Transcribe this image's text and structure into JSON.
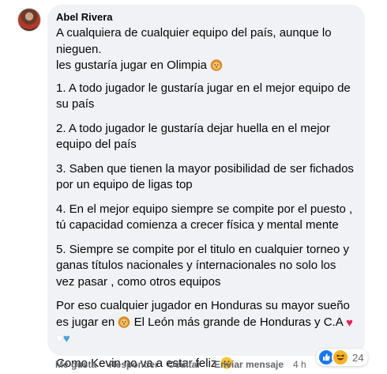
{
  "comment": {
    "author": "Abel Rivera",
    "paragraphs": {
      "p0_line1": "A cualquiera de cualquier equipo del país, aunque lo nieguen.",
      "p0_line2": "les gustaría jugar en Olimpia",
      "p1": "1. A todo jugador le gustaría jugar en el mejor equipo de su país",
      "p2": "2. A todo jugador le gustaría dejar huella en el mejor equipo del país",
      "p3": "3. Saben que tienen la mayor posibilidad de ser fichados por un equipo de ligas top",
      "p4": "4. En el mejor equipo siempre se compite por el puesto , tú capacidad comienza a crecer física y mental mente",
      "p5": "5. Siempre se compite por el titulo en cualquier torneo y ganas títulos nacionales y ínternacionales no solo los vez pasar , como otros equipos",
      "p6_a": "Por eso cualquier jugador en Honduras su mayor sueño es jugar en",
      "p6_b": "El León más grande de Honduras y C.A",
      "p7": "Como Kevin no va a estar feliz"
    },
    "emojis": {
      "lion": "lion-face",
      "hearts": [
        "red-heart",
        "white-heart",
        "blue-heart"
      ],
      "smile": "grinning-face"
    }
  },
  "actions": {
    "like": "Me gusta",
    "reply": "Responder",
    "hide": "Ocultar",
    "send_message": "Enviar mensaje",
    "time": "4 h"
  },
  "reactions": {
    "types": [
      "like",
      "haha"
    ],
    "count": "24"
  },
  "colors": {
    "bubble": "#f0f2f5",
    "text": "#050505",
    "meta": "#65676b",
    "like_blue": "#1877f2",
    "haha_yellow": "#f7b125"
  }
}
